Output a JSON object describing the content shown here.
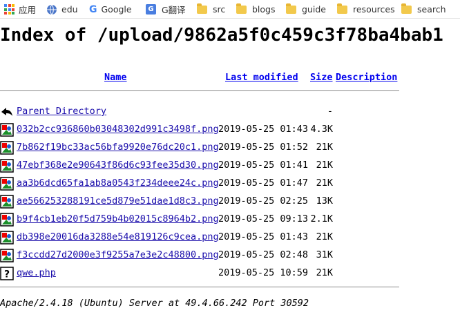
{
  "bookmarks": [
    {
      "label": "应用",
      "icon": "apps-grid-icon"
    },
    {
      "label": "edu",
      "icon": "globe-icon"
    },
    {
      "label": "Google",
      "icon": "google-icon"
    },
    {
      "label": "G翻译",
      "icon": "google-translate-icon"
    },
    {
      "label": "src",
      "icon": "folder-icon"
    },
    {
      "label": "blogs",
      "icon": "folder-icon"
    },
    {
      "label": "guide",
      "icon": "folder-icon"
    },
    {
      "label": "resources",
      "icon": "folder-icon"
    },
    {
      "label": "search",
      "icon": "folder-icon"
    }
  ],
  "page": {
    "title": "Index of /upload/9862a5f0c459c3f78ba4bab1"
  },
  "table": {
    "headers": {
      "name": "Name",
      "modified": "Last modified",
      "size": "Size",
      "description": "Description"
    },
    "parent": {
      "label": "Parent Directory",
      "size": "-"
    },
    "rows": [
      {
        "name": "032b2cc936860b03048302d991c3498f.png",
        "modified": "2019-05-25 01:43",
        "size": "4.3K",
        "icon": "image-file-icon"
      },
      {
        "name": "7b862f19bc33ac56bfa9920e76dc20c1.png",
        "modified": "2019-05-25 01:52",
        "size": "21K",
        "icon": "image-file-icon"
      },
      {
        "name": "47ebf368e2e90643f86d6c93fee35d30.png",
        "modified": "2019-05-25 01:41",
        "size": "21K",
        "icon": "image-file-icon"
      },
      {
        "name": "aa3b6dcd65fa1ab8a0543f234deee24c.png",
        "modified": "2019-05-25 01:47",
        "size": "21K",
        "icon": "image-file-icon"
      },
      {
        "name": "ae566253288191ce5d879e51dae1d8c3.png",
        "modified": "2019-05-25 02:25",
        "size": "13K",
        "icon": "image-file-icon"
      },
      {
        "name": "b9f4cb1eb20f5d759b4b02015c8964b2.png",
        "modified": "2019-05-25 09:13",
        "size": "2.1K",
        "icon": "image-file-icon"
      },
      {
        "name": "db398e20016da3288e54e819126c9cea.png",
        "modified": "2019-05-25 01:43",
        "size": "21K",
        "icon": "image-file-icon"
      },
      {
        "name": "f3ccdd27d2000e3f9255a7e3e2c48800.png",
        "modified": "2019-05-25 02:48",
        "size": "31K",
        "icon": "image-file-icon"
      },
      {
        "name": "qwe.php",
        "modified": "2019-05-25 10:59",
        "size": "21K",
        "icon": "unknown-file-icon"
      }
    ]
  },
  "footer": {
    "text": "Apache/2.4.18 (Ubuntu) Server at 49.4.66.242 Port 30592"
  }
}
